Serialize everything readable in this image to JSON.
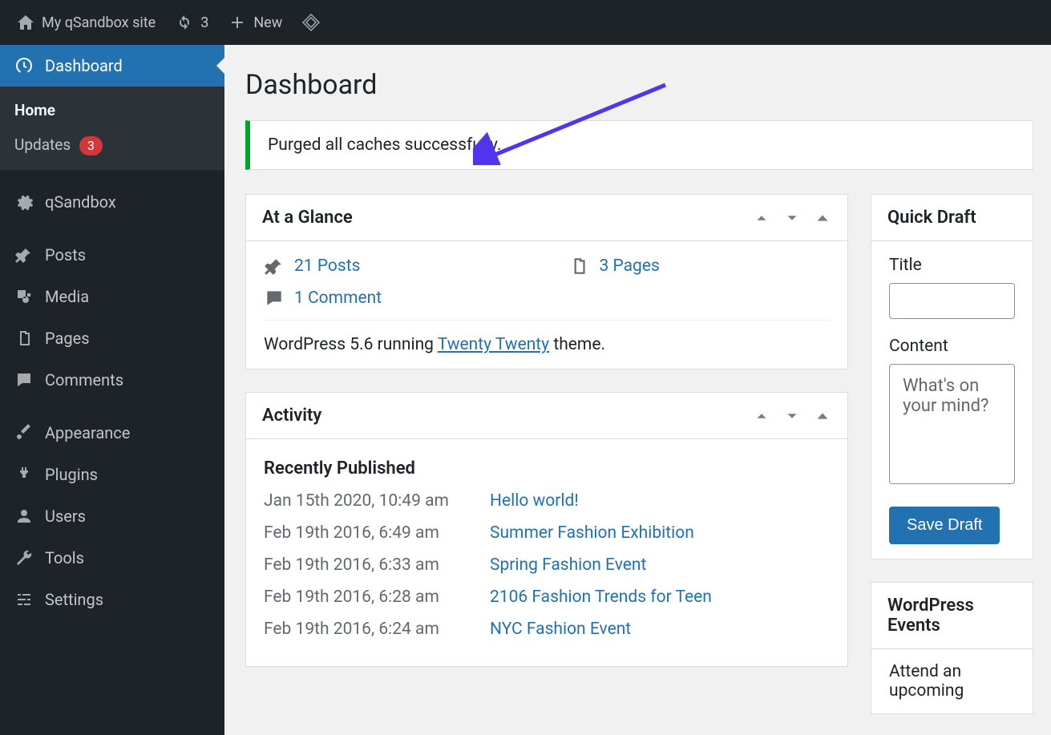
{
  "adminbar": {
    "site_name": "My qSandbox site",
    "updates_count": "3",
    "new_label": "New"
  },
  "sidebar": {
    "dashboard": "Dashboard",
    "home": "Home",
    "updates": "Updates",
    "updates_badge": "3",
    "qsandbox": "qSandbox",
    "posts": "Posts",
    "media": "Media",
    "pages": "Pages",
    "comments": "Comments",
    "appearance": "Appearance",
    "plugins": "Plugins",
    "users": "Users",
    "tools": "Tools",
    "settings": "Settings"
  },
  "page": {
    "title": "Dashboard",
    "notice": "Purged all caches successfully."
  },
  "glance": {
    "title": "At a Glance",
    "posts": "21 Posts",
    "pages": "3 Pages",
    "comments": "1 Comment",
    "ver_prefix": "WordPress 5.6 running ",
    "theme": "Twenty Twenty",
    "ver_suffix": " theme."
  },
  "activity": {
    "title": "Activity",
    "subtitle": "Recently Published",
    "items": [
      {
        "date": "Jan 15th 2020, 10:49 am",
        "title": "Hello world!"
      },
      {
        "date": "Feb 19th 2016, 6:49 am",
        "title": "Summer Fashion Exhibition"
      },
      {
        "date": "Feb 19th 2016, 6:33 am",
        "title": "Spring Fashion Event"
      },
      {
        "date": "Feb 19th 2016, 6:28 am",
        "title": "2106 Fashion Trends for Teen"
      },
      {
        "date": "Feb 19th 2016, 6:24 am",
        "title": "NYC Fashion Event"
      }
    ]
  },
  "quickdraft": {
    "title": "Quick Draft",
    "title_label": "Title",
    "content_label": "Content",
    "content_placeholder": "What's on your mind?",
    "save": "Save Draft"
  },
  "events": {
    "title": "WordPress Events",
    "text": "Attend an upcoming"
  }
}
